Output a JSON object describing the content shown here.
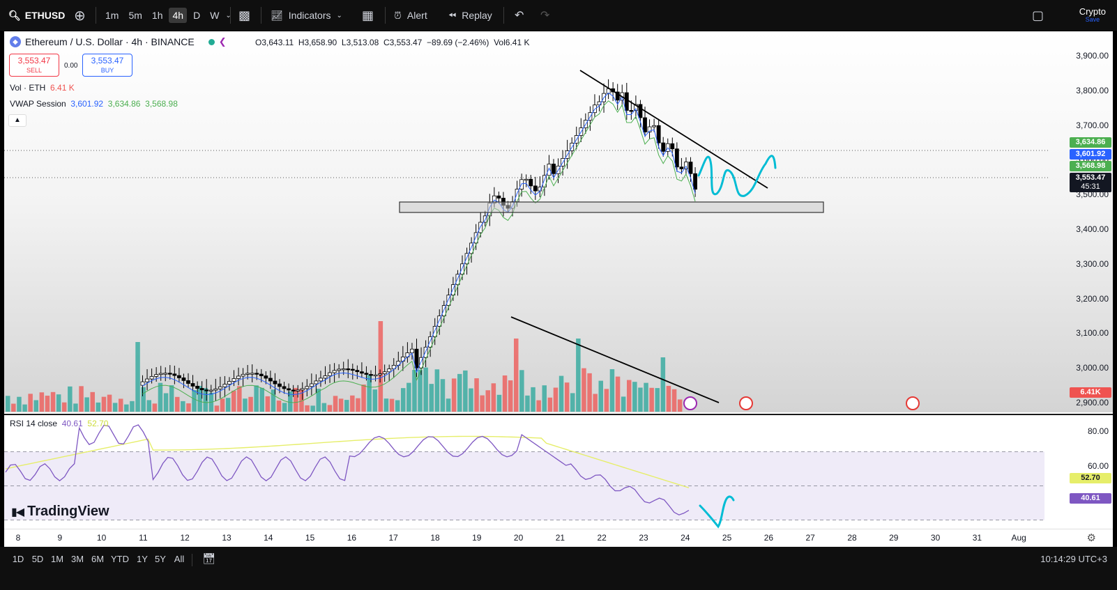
{
  "toolbar": {
    "symbol": "ETHUSD",
    "intervals": [
      "1m",
      "5m",
      "1h",
      "4h",
      "D",
      "W"
    ],
    "active_interval": "4h",
    "indicators_label": "Indicators",
    "alert_label": "Alert",
    "replay_label": "Replay",
    "crypto_label": "Crypto",
    "save_label": "Save"
  },
  "legend": {
    "title": "Ethereum / U.S. Dollar · 4h · BINANCE",
    "open": "O3,643.11",
    "high": "H3,658.90",
    "low": "L3,513.08",
    "close": "C3,553.47",
    "change": "−89.69 (−2.46%)",
    "volume": "Vol6.41 K"
  },
  "trade": {
    "sell_price": "3,553.47",
    "sell_label": "SELL",
    "spread": "0.00",
    "buy_price": "3,553.47",
    "buy_label": "BUY"
  },
  "indicators": {
    "vol_label": "Vol · ETH",
    "vol_value": "6.41 K",
    "vwap_label": "VWAP Session",
    "vwap_v1": "3,601.92",
    "vwap_v2": "3,634.86",
    "vwap_v3": "3,568.98",
    "rsi_label": "RSI 14 close",
    "rsi_value": "40.61",
    "rsi_ma": "52.70"
  },
  "price_axis": [
    "3,900.00",
    "3,800.00",
    "3,700.00",
    "3,600.00",
    "3,500.00",
    "3,400.00",
    "3,300.00",
    "3,200.00",
    "3,100.00",
    "3,000.00",
    "2,900.00"
  ],
  "price_tags": {
    "vwap_upper": "3,634.86",
    "vwap_mid": "3,601.92",
    "vwap_lower": "3,568.98",
    "last_price": "3,553.47",
    "countdown": "45:31",
    "volume": "6.41K"
  },
  "rsi_axis": [
    "80.00",
    "60.00"
  ],
  "rsi_tags": {
    "ma": "52.70",
    "rsi": "40.61"
  },
  "time_axis": [
    "8",
    "9",
    "10",
    "11",
    "12",
    "13",
    "14",
    "15",
    "16",
    "17",
    "18",
    "19",
    "20",
    "21",
    "22",
    "23",
    "24",
    "25",
    "26",
    "27",
    "28",
    "29",
    "30",
    "31",
    "Aug"
  ],
  "branding": "TradingView",
  "ranges": [
    "1D",
    "5D",
    "1M",
    "3M",
    "6M",
    "YTD",
    "1Y",
    "5Y",
    "All"
  ],
  "clock": "10:14:29 UTC+3",
  "colors": {
    "up": "#ffffff",
    "down": "#000000",
    "vol_up": "#26a69a",
    "vol_down": "#ef5350",
    "vwap": "#2962ff",
    "vwap_band": "#4caf50",
    "rsi": "#7e57c2",
    "rsi_ma": "#e6ee6a",
    "drawing": "#00bcd4"
  }
}
